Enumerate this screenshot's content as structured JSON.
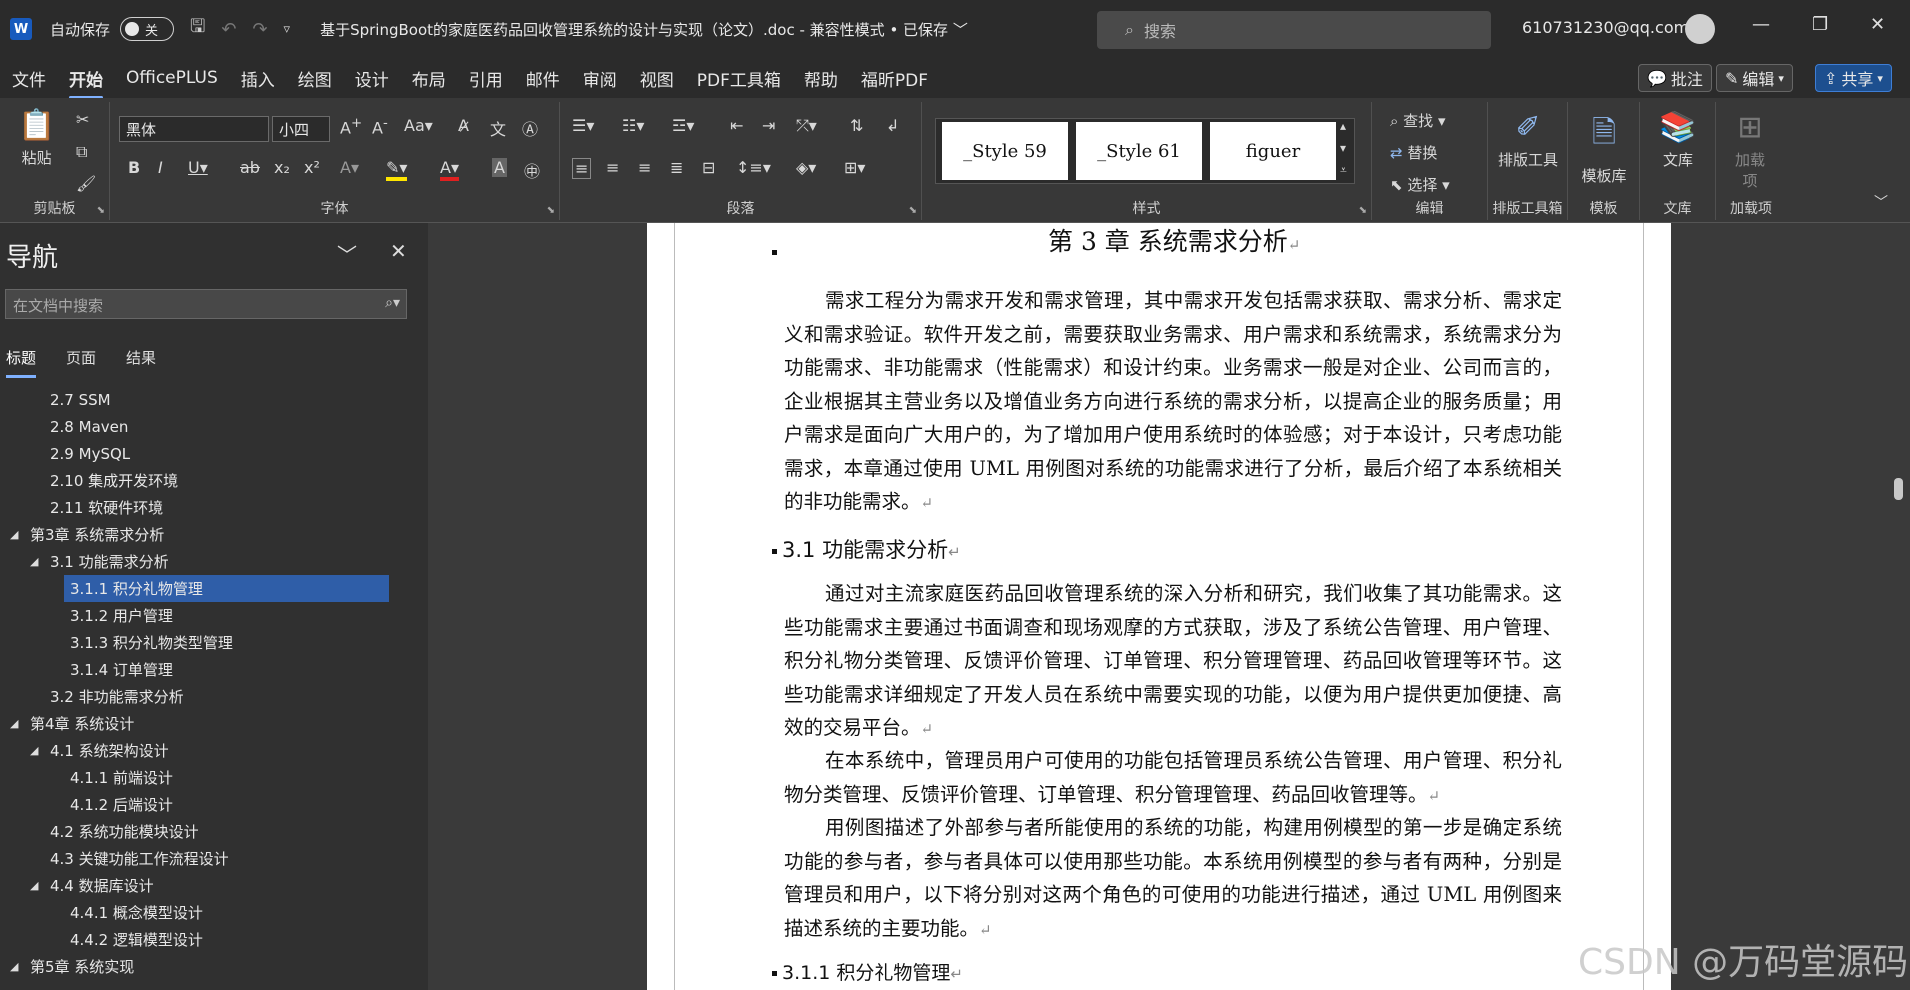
{
  "titlebar": {
    "logo": "W",
    "autosave_label": "自动保存",
    "autosave_state": "关",
    "doc_title": "基于SpringBoot的家庭医药品回收管理系统的设计与实现（论文）.doc  -  兼容性模式 • 已保存 ﹀",
    "search_placeholder": "搜索",
    "user_email": "610731230@qq.com"
  },
  "menu": [
    "文件",
    "开始",
    "OfficePLUS",
    "插入",
    "绘图",
    "设计",
    "布局",
    "引用",
    "邮件",
    "审阅",
    "视图",
    "PDF工具箱",
    "帮助",
    "福昕PDF"
  ],
  "menu_right": {
    "comments": "批注",
    "editing": "编辑",
    "share": "共享"
  },
  "ribbon": {
    "clipboard": {
      "paste": "粘贴",
      "label": "剪贴板"
    },
    "font": {
      "name": "黑体",
      "size": "小四",
      "label": "字体"
    },
    "paragraph": {
      "label": "段落"
    },
    "styles": {
      "tiles": [
        "_Style 59",
        "_Style 61",
        "figuer"
      ],
      "label": "样式"
    },
    "editing": {
      "find": "查找",
      "replace": "替换",
      "select": "选择",
      "label": "编辑"
    },
    "layout_tool": {
      "btn": "排版工具",
      "label": "排版工具箱"
    },
    "template": {
      "btn": "模板库",
      "label": "模板"
    },
    "library": {
      "btn": "文库",
      "label": "文库"
    },
    "addins": {
      "btn": "加载项",
      "label": "加载项"
    }
  },
  "nav": {
    "title": "导航",
    "search_placeholder": "在文档中搜索",
    "tabs": [
      "标题",
      "页面",
      "结果"
    ],
    "items": [
      "2.7 SSM",
      "2.8   Maven",
      "2.9   MySQL",
      "2.10   集成开发环境",
      "2.11   软硬件环境",
      "第3章 系统需求分析",
      "3.1  功能需求分析",
      "3.1.1  积分礼物管理",
      "3.1.2  用户管理",
      "3.1.3  积分礼物类型管理",
      "3.1.4  订单管理",
      "3.2  非功能需求分析",
      "第4章 系统设计",
      "4.1  系统架构设计",
      "4.1.1  前端设计",
      "4.1.2  后端设计",
      "4.2  系统功能模块设计",
      "4.3  关键功能工作流程设计",
      "4.4  数据库设计",
      "4.4.1  概念模型设计",
      "4.4.2  逻辑模型设计",
      "第5章 系统实现"
    ]
  },
  "document": {
    "chapter_title": "第 3 章  系统需求分析",
    "para1": "需求工程分为需求开发和需求管理，其中需求开发包括需求获取、需求分析、需求定义和需求验证。软件开发之前，需要获取业务需求、用户需求和系统需求，系统需求分为功能需求、非功能需求（性能需求）和设计约束。业务需求一般是对企业、公司而言的，企业根据其主营业务以及增值业务方向进行系统的需求分析，以提高企业的服务质量；用户需求是面向广大用户的，为了增加用户使用系统时的体验感；对于本设计，只考虑功能需求，本章通过使用 UML 用例图对系统的功能需求进行了分析，最后介绍了本系统相关的非功能需求。",
    "heading_31": "3.1    功能需求分析",
    "para2": "通过对主流家庭医药品回收管理系统的深入分析和研究，我们收集了其功能需求。这些功能需求主要通过书面调查和现场观摩的方式获取，涉及了系统公告管理、用户管理、积分礼物分类管理、反馈评价管理、订单管理、积分管理管理、药品回收管理等环节。这些功能需求详细规定了开发人员在系统中需要实现的功能，以便为用户提供更加便捷、高效的交易平台。",
    "para3": "在本系统中，管理员用户可使用的功能包括管理员系统公告管理、用户管理、积分礼物分类管理、反馈评价管理、订单管理、积分管理管理、药品回收管理等。",
    "para4": "用例图描述了外部参与者所能使用的系统的功能，构建用例模型的第一步是确定系统功能的参与者，参与者具体可以使用那些功能。本系统用例模型的参与者有两种，分别是管理员和用户，以下将分别对这两个角色的可使用的功能进行描述，通过 UML 用例图来描述系统的主要功能。",
    "heading_311": "3.1.1    积分礼物管理",
    "para_mark": "↵"
  },
  "watermark": "CSDN @万码堂源码",
  "colors": {
    "accent": "#7fb1ff",
    "selected": "#2f5ea8",
    "word_blue": "#185abd"
  }
}
